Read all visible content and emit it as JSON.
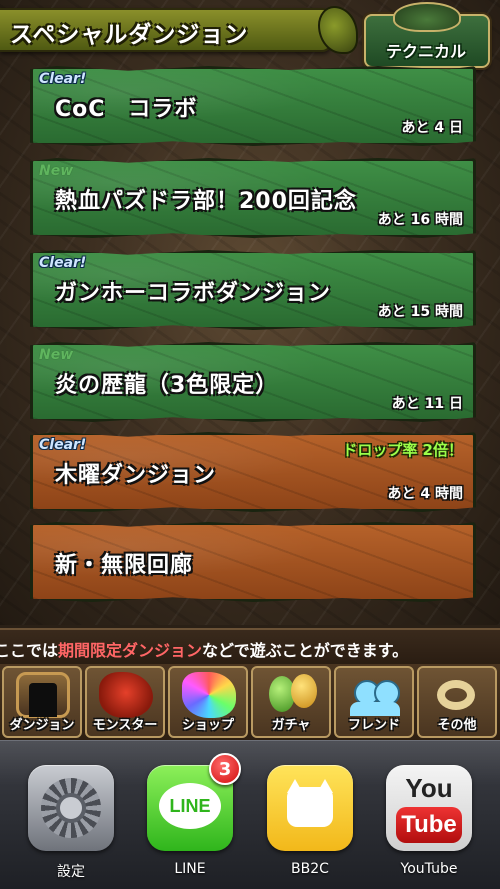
{
  "header": {
    "title": "スペシャルダンジョン",
    "mode_label": "テクニカル"
  },
  "dungeons": [
    {
      "tag": "Clear!",
      "name": "CoC　コラボ",
      "remaining": "あと 4 日",
      "bonus": "",
      "color": "green"
    },
    {
      "tag": "New",
      "name": "熱血パズドラ部！200回記念",
      "remaining": "あと 16 時間",
      "bonus": "",
      "color": "green"
    },
    {
      "tag": "Clear!",
      "name": "ガンホーコラボダンジョン",
      "remaining": "あと 15 時間",
      "bonus": "",
      "color": "green"
    },
    {
      "tag": "New",
      "name": "炎の歴龍（3色限定）",
      "remaining": "あと 11 日",
      "bonus": "",
      "color": "green"
    },
    {
      "tag": "Clear!",
      "name": "木曜ダンジョン",
      "remaining": "あと 4 時間",
      "bonus": "ドロップ率 2倍！",
      "color": "orange"
    },
    {
      "tag": "",
      "name": "新・無限回廊",
      "remaining": "",
      "bonus": "",
      "color": "orange"
    }
  ],
  "ticker": {
    "before": "ここでは",
    "highlight": "期間限定ダンジョン",
    "after": "などで遊ぶことができます。"
  },
  "nav": [
    {
      "label": "ダンジョン",
      "icon": "dungeon-gate-icon"
    },
    {
      "label": "モンスター",
      "icon": "red-dragon-icon"
    },
    {
      "label": "ショップ",
      "icon": "rainbow-stone-icon"
    },
    {
      "label": "ガチャ",
      "icon": "eggs-icon"
    },
    {
      "label": "フレンド",
      "icon": "friends-icon"
    },
    {
      "label": "その他",
      "icon": "other-ring-icon"
    }
  ],
  "dock": [
    {
      "label": "設定",
      "icon": "settings-gear-icon",
      "badge": ""
    },
    {
      "label": "LINE",
      "icon": "line-app-icon",
      "badge": "3"
    },
    {
      "label": "BB2C",
      "icon": "bb2c-cat-icon",
      "badge": ""
    },
    {
      "label": "YouTube",
      "icon": "youtube-app-icon",
      "badge": ""
    }
  ],
  "colors": {
    "green_panel": "#3f8f46",
    "orange_panel": "#b6622a",
    "ticker_highlight": "#ff6666",
    "bonus_text": "#9cff4a",
    "clear_tag": "#cfe6ff"
  }
}
